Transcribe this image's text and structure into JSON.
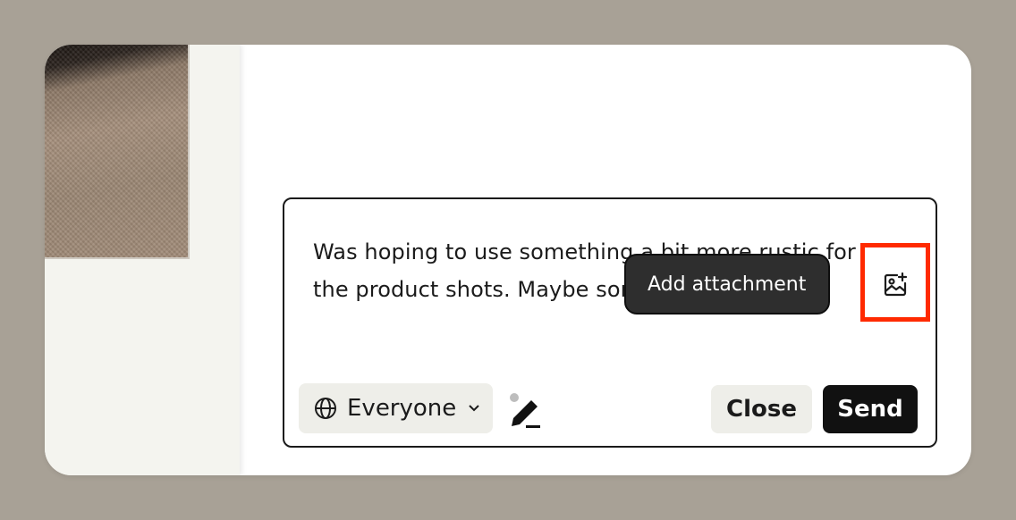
{
  "composer": {
    "message": "Was hoping to use something a bit more rustic for the product shots. Maybe something like this?",
    "audience_label": "Everyone",
    "close_label": "Close",
    "send_label": "Send"
  },
  "tooltip": {
    "text": "Add attachment"
  },
  "icons": {
    "audience": "globe-icon",
    "audience_dropdown": "chevron-down-icon",
    "signature": "signature-pen-icon",
    "attachment": "image-plus-icon"
  },
  "colors": {
    "background": "#a8a196",
    "send_button": "#111111",
    "tooltip": "#2e2e2e",
    "highlight": "#ff2a00"
  }
}
